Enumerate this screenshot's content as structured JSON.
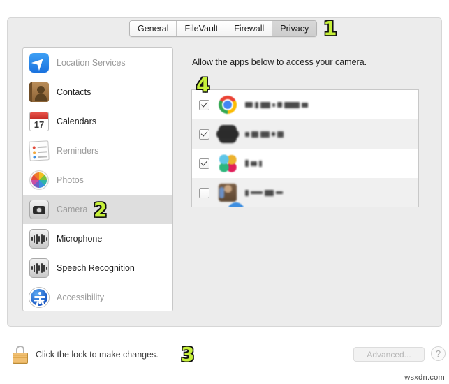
{
  "window": {
    "tabs": [
      {
        "label": "General",
        "selected": false
      },
      {
        "label": "FileVault",
        "selected": false
      },
      {
        "label": "Firewall",
        "selected": false
      },
      {
        "label": "Privacy",
        "selected": true
      }
    ]
  },
  "sidebar": {
    "items": [
      {
        "label": "Location Services",
        "icon": "location-arrow-icon",
        "enabled": false,
        "selected": false
      },
      {
        "label": "Contacts",
        "icon": "contacts-book-icon",
        "enabled": true,
        "selected": false
      },
      {
        "label": "Calendars",
        "icon": "calendar-icon",
        "enabled": true,
        "selected": false,
        "day": "17"
      },
      {
        "label": "Reminders",
        "icon": "reminders-list-icon",
        "enabled": false,
        "selected": false
      },
      {
        "label": "Photos",
        "icon": "photos-pinwheel-icon",
        "enabled": false,
        "selected": false
      },
      {
        "label": "Camera",
        "icon": "camera-icon",
        "enabled": false,
        "selected": true
      },
      {
        "label": "Microphone",
        "icon": "microphone-waveform-icon",
        "enabled": true,
        "selected": false
      },
      {
        "label": "Speech Recognition",
        "icon": "speech-waveform-icon",
        "enabled": true,
        "selected": false
      },
      {
        "label": "Accessibility",
        "icon": "accessibility-icon",
        "enabled": false,
        "selected": false
      }
    ]
  },
  "main": {
    "title": "Allow the apps below to access your camera.",
    "apps": [
      {
        "icon": "chrome-app-icon",
        "checked": true,
        "name_redacted": true
      },
      {
        "icon": "dark-app-icon",
        "checked": true,
        "name_redacted": true
      },
      {
        "icon": "slack-app-icon",
        "checked": true,
        "name_redacted": true
      },
      {
        "icon": "person-app-icon",
        "checked": false,
        "name_redacted": true
      }
    ]
  },
  "footer": {
    "lock_icon": "padlock-closed-icon",
    "lock_text": "Click the lock to make changes.",
    "advanced_label": "Advanced...",
    "help_label": "?"
  },
  "annotations": [
    {
      "id": "1",
      "value": "1",
      "target": "privacy-tab"
    },
    {
      "id": "2",
      "value": "2",
      "target": "camera-sidebar-item"
    },
    {
      "id": "3",
      "value": "3",
      "target": "lock-button"
    },
    {
      "id": "4",
      "value": "4",
      "target": "app-list"
    }
  ],
  "watermark": "wsxdn.com",
  "colors": {
    "annotation_fill": "#c6f03a",
    "annotation_stroke": "#111111",
    "window_bg": "#ececec",
    "selected_row": "#dedede"
  }
}
